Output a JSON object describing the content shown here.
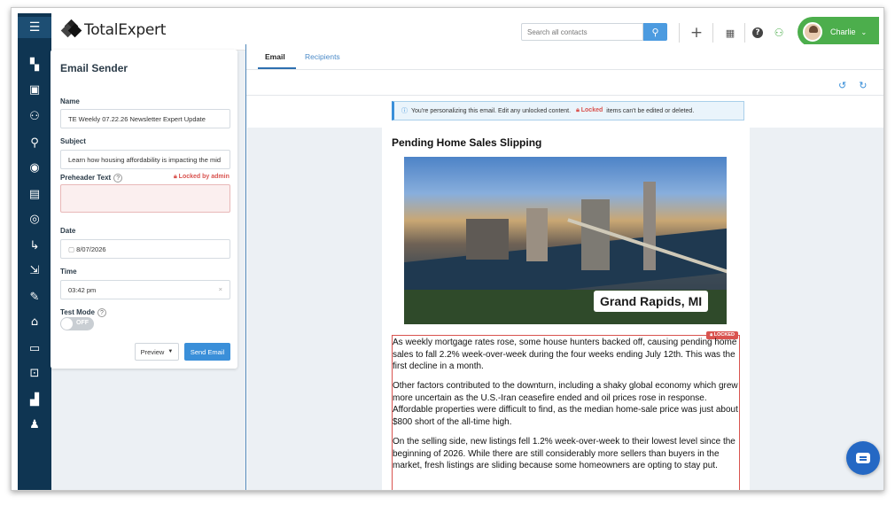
{
  "header": {
    "logo_text": "TotalExpert",
    "search_placeholder": "Search all contacts",
    "user_name": "Charlie"
  },
  "rail": {
    "icons": [
      "menu-icon",
      "dashboard-icon",
      "book-icon",
      "people-icon",
      "dollar-person-icon",
      "speedometer-icon",
      "calendar-icon",
      "target-icon",
      "flow-icon",
      "share-icon",
      "pen-icon",
      "home-icon",
      "monitor-icon",
      "inbox-icon",
      "analytics-icon",
      "user-icon"
    ]
  },
  "sender": {
    "title": "Email Sender",
    "name_label": "Name",
    "name_value": "TE Weekly 07.22.26 Newsletter Expert Update",
    "subject_label": "Subject",
    "subject_value": "Learn how housing affordability is impacting the mid",
    "preheader_label": "Preheader Text",
    "locked_by_admin": "Locked by admin",
    "date_label": "Date",
    "date_value": "8/07/2026",
    "time_label": "Time",
    "time_value": "03:42 pm",
    "test_mode_label": "Test Mode",
    "toggle_text": "OFF",
    "preview_label": "Preview",
    "send_label": "Send Email"
  },
  "editor": {
    "tab_email": "Email",
    "tab_recipients": "Recipients",
    "notice_text": "You're personalizing this email. Edit any unlocked content.",
    "notice_locked": "Locked",
    "notice_tail": "items can't be edited or deleted.",
    "email_title": "Pending Home Sales Slipping",
    "image_caption": "Grand Rapids, MI",
    "locked_tag": "LOCKED",
    "paragraphs": [
      "As weekly mortgage rates rose, some house hunters backed off, causing pending home sales to fall 2.2% week-over-week during the four weeks ending July 12th. This was the first decline in a month.",
      "Other factors contributed to the downturn, including a shaky global economy which grew more uncertain as the U.S.-Iran ceasefire ended and oil prices rose in response. Affordable properties were difficult to find, as the median home-sale price was just about $800 short of the all-time high.",
      "On the selling side, new listings fell 1.2% week-over-week to their lowest level since the beginning of 2026. While there are still considerably more sellers than buyers in the market, fresh listings are sliding because some homeowners are opting to stay put."
    ]
  },
  "colors": {
    "rail": "#0f3552",
    "accent_blue": "#3a8fd9",
    "user_green": "#4cae4c",
    "locked_red": "#d9534f"
  }
}
